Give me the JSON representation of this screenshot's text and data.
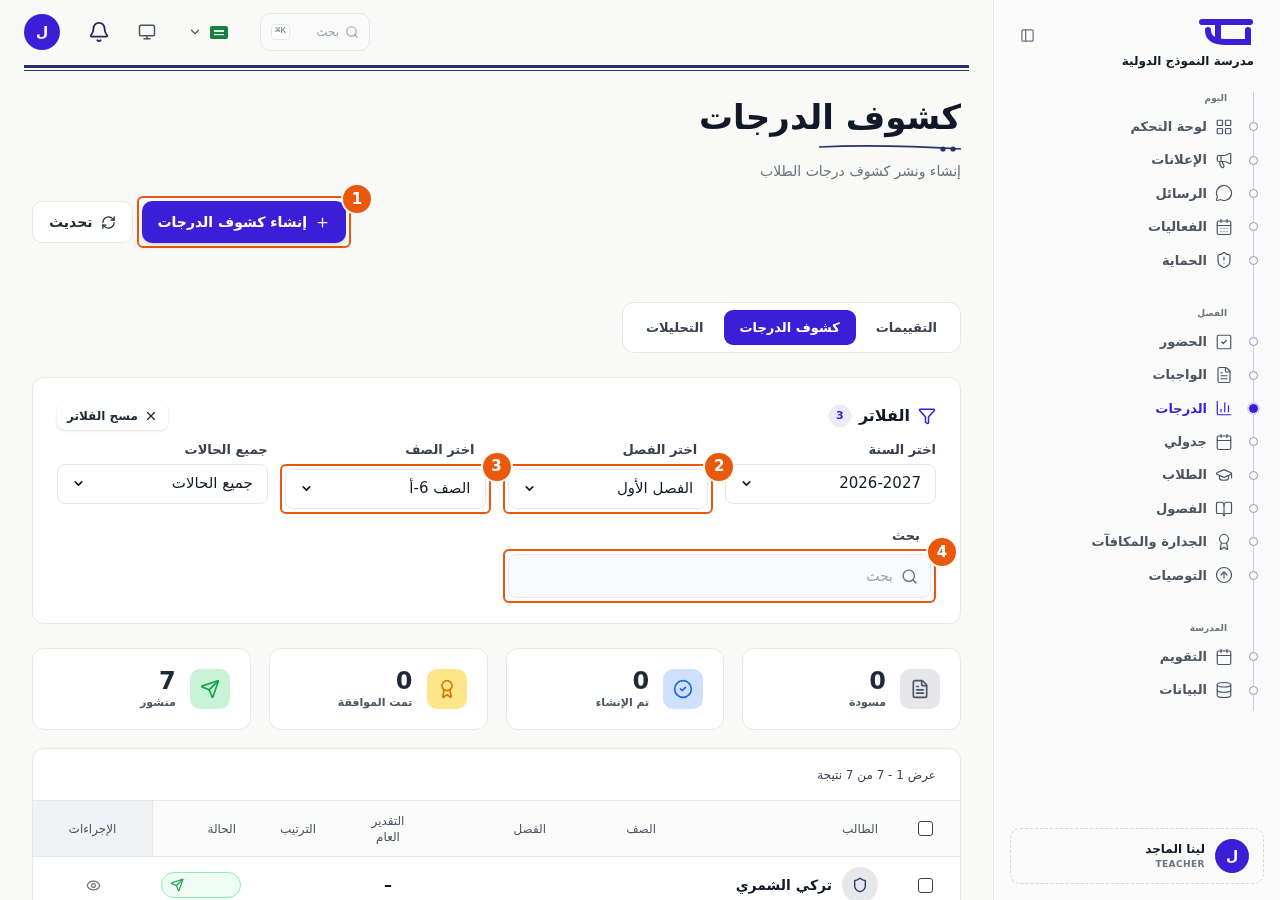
{
  "topbar": {
    "avatar": "ل",
    "search": {
      "placeholder": "بحث",
      "shortcut": "K⌘"
    }
  },
  "sidebar": {
    "school_name": "مدرسة النموذج الدولية",
    "sections": [
      {
        "title": "اليوم",
        "items": [
          {
            "label": "لوحة التحكم",
            "selected": false
          },
          {
            "label": "الإعلانات",
            "selected": false
          },
          {
            "label": "الرسائل",
            "selected": false
          },
          {
            "label": "الفعاليات",
            "selected": false
          },
          {
            "label": "الحماية",
            "selected": false
          }
        ]
      },
      {
        "title": "الفصل",
        "items": [
          {
            "label": "الحضور",
            "selected": false
          },
          {
            "label": "الواجبات",
            "selected": false
          },
          {
            "label": "الدرجات",
            "selected": true
          },
          {
            "label": "جدولي",
            "selected": false
          },
          {
            "label": "الطلاب",
            "selected": false
          },
          {
            "label": "الفصول",
            "selected": false
          },
          {
            "label": "الجدارة والمكافآت",
            "selected": false
          },
          {
            "label": "التوصيات",
            "selected": false
          }
        ]
      },
      {
        "title": "المدرسة",
        "items": [
          {
            "label": "التقويم",
            "selected": false
          },
          {
            "label": "البيانات",
            "selected": false
          }
        ]
      }
    ],
    "user": {
      "initial": "ل",
      "name": "لينا الماجد",
      "role": "TEACHER"
    }
  },
  "page": {
    "title": "كشوف الدرجات",
    "subtitle": "إنشاء ونشر كشوف درجات الطلاب"
  },
  "actions": [
    {
      "label": "إنشاء كشوف الدرجات",
      "kind": "primary",
      "callout": "1"
    },
    {
      "label": "تحديث",
      "kind": "secondary"
    }
  ],
  "tabs": [
    {
      "label": "التقييمات",
      "selected": false
    },
    {
      "label": "كشوف الدرجات",
      "selected": true
    },
    {
      "label": "التحليلات",
      "selected": false
    }
  ],
  "filters": {
    "title": "الفلاتر",
    "count": "3",
    "clear": "مسح الفلاتر",
    "selects": [
      {
        "label": "اختر السنة",
        "value": "2026-2027"
      },
      {
        "label": "اختر الفصل",
        "value": "الفصل الأول",
        "callout": "2"
      },
      {
        "label": "اختر الصف",
        "value": "الصف 6-أ",
        "callout": "3"
      },
      {
        "label": "جميع الحالات",
        "value": "جميع الحالات"
      }
    ],
    "search": {
      "label": "بحث",
      "placeholder": "بحث",
      "callout": "4"
    }
  },
  "stats": [
    {
      "label": "مسودة",
      "value": "0",
      "color": "#e5e7eb"
    },
    {
      "label": "تم الإنشاء",
      "value": "0",
      "color": "#cfe0fd"
    },
    {
      "label": "تمت الموافقة",
      "value": "0",
      "color": "#fde68a"
    },
    {
      "label": "منشور",
      "value": "7",
      "color": "#c8f3d6"
    }
  ],
  "table": {
    "summary": "عرض 1 - 7 من 7 نتيجة",
    "all_checked": false,
    "columns": [
      "الطالب",
      "الصف",
      "الفصل",
      "التقدير العام",
      "الترتيب",
      "الحالة",
      "الإجراءات"
    ],
    "rows": [
      {
        "name": "تركي الشمري",
        "grade": "–",
        "checked": false
      }
    ]
  }
}
